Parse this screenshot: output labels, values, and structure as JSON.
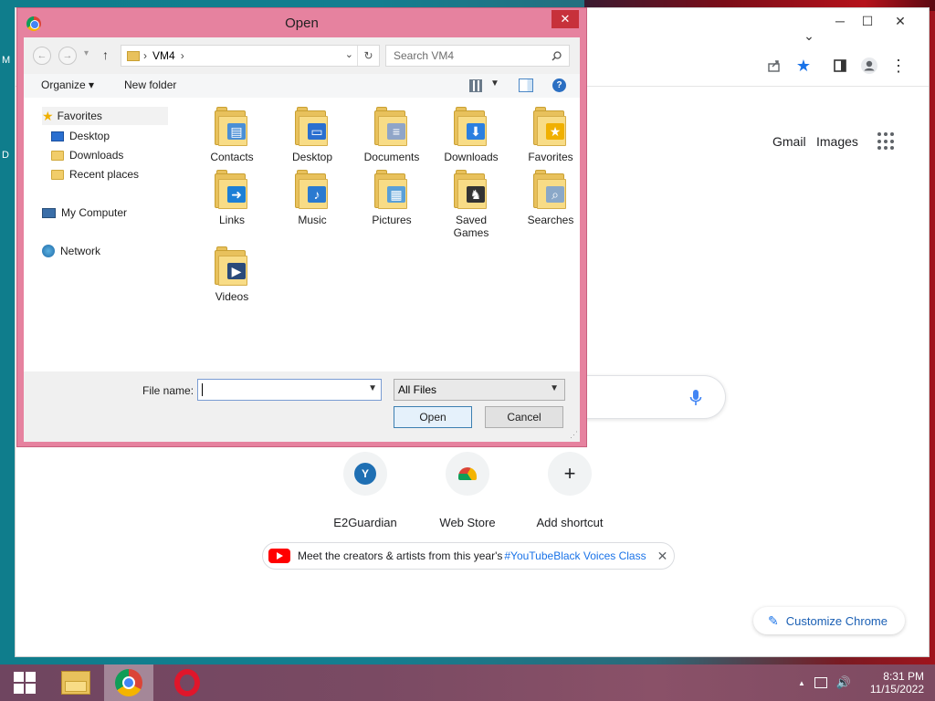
{
  "desktop": {
    "icon_labels": [
      "M",
      "D"
    ]
  },
  "chrome": {
    "window_controls": {
      "minimize": "─",
      "maximize": "☐",
      "close": "✕"
    },
    "tab_dropdown": "⌄",
    "header_links": {
      "gmail": "Gmail",
      "images": "Images"
    },
    "shortcuts": [
      {
        "letter": "Y",
        "label": "E2Guardian"
      },
      {
        "letter": "",
        "label": "Web Store"
      },
      {
        "letter": "+",
        "label": "Add shortcut"
      }
    ],
    "promo": {
      "text": "Meet the creators & artists from this year's ",
      "tag": "#YouTubeBlack Voices Class",
      "close": "✕"
    },
    "customize_label": "Customize Chrome"
  },
  "dialog": {
    "title": "Open",
    "close": "✕",
    "nav": {
      "back": "←",
      "forward": "→",
      "up": "↑",
      "history": "▾"
    },
    "address": {
      "location": "VM4",
      "sep": "›"
    },
    "search_placeholder": "Search VM4",
    "commands": {
      "organize": "Organize ▾",
      "new_folder": "New folder"
    },
    "nav_pane": {
      "favorites": "Favorites",
      "favorites_children": [
        "Desktop",
        "Downloads",
        "Recent places"
      ],
      "computer": "My Computer",
      "network": "Network"
    },
    "files": [
      {
        "name": "Contacts",
        "emblem": "▤",
        "color": "#4a8fd6"
      },
      {
        "name": "Desktop",
        "emblem": "▭",
        "color": "#2a6fd0"
      },
      {
        "name": "Documents",
        "emblem": "≡",
        "color": "#8fa5c8"
      },
      {
        "name": "Downloads",
        "emblem": "⬇",
        "color": "#2b7fe0"
      },
      {
        "name": "Favorites",
        "emblem": "★",
        "color": "#f0b000"
      },
      {
        "name": "Links",
        "emblem": "➜",
        "color": "#1c7fd6"
      },
      {
        "name": "Music",
        "emblem": "♪",
        "color": "#2a7ad0"
      },
      {
        "name": "Pictures",
        "emblem": "▦",
        "color": "#5aa0d8"
      },
      {
        "name": "Saved\nGames",
        "emblem": "♞",
        "color": "#333333"
      },
      {
        "name": "Searches",
        "emblem": "⌕",
        "color": "#8aa8c8"
      },
      {
        "name": "Videos",
        "emblem": "▶",
        "color": "#2a4a7a"
      }
    ],
    "file_name_label": "File name:",
    "file_name_value": "",
    "file_type": "All Files",
    "open_button": "Open",
    "cancel_button": "Cancel"
  },
  "taskbar": {
    "time": "8:31 PM",
    "date": "11/15/2022",
    "tray_up": "▲"
  }
}
